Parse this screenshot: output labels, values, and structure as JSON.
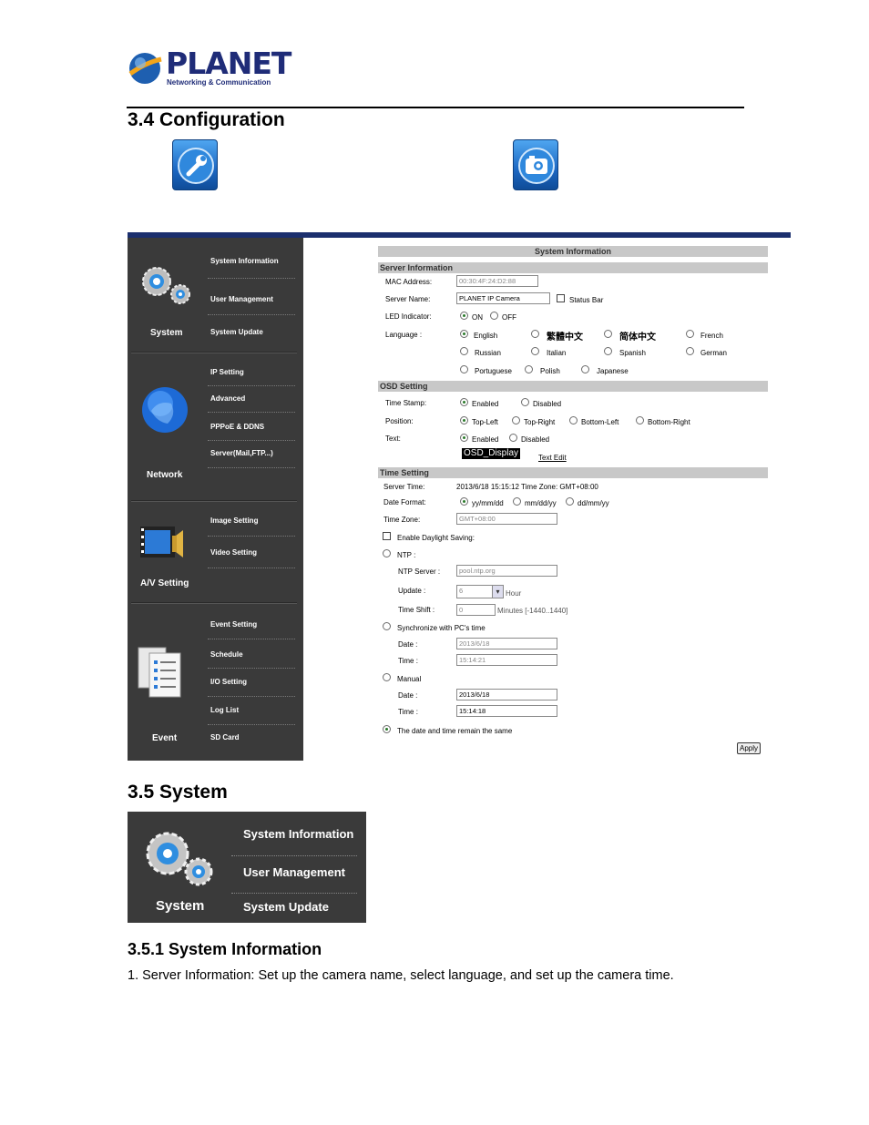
{
  "header": {
    "brand_name": "PLANET",
    "brand_tagline": "Networking & Communication"
  },
  "sections": {
    "config_title": "3.4 Configuration",
    "system_title": "3.5 System",
    "sysinfo_title": "3.5.1 System Information",
    "body_text": "1. Server Information: Set up the camera name, select language, and set up the camera time."
  },
  "icons": [
    "wrench-icon",
    "camera-icon",
    "gear-icon",
    "globe-icon",
    "film-icon",
    "documents-icon"
  ],
  "sidebar": {
    "groups": {
      "system": "System",
      "network": "Network",
      "av": "A/V Setting",
      "event": "Event"
    },
    "items": {
      "system_information": "System Information",
      "user_management": "User Management",
      "system_update": "System Update",
      "ip_setting": "IP Setting",
      "advanced": "Advanced",
      "pppoe": "PPPoE & DDNS",
      "server": "Server(Mail,FTP...)",
      "image_setting": "Image Setting",
      "video_setting": "Video Setting",
      "event_setting": "Event Setting",
      "schedule": "Schedule",
      "io_setting": "I/O Setting",
      "log_list": "Log List",
      "sd_card": "SD Card"
    }
  },
  "form": {
    "title": "System Information",
    "server_info": "Server Information",
    "mac_label": "MAC Address:",
    "mac_value": "00:30:4F:24:D2:88",
    "server_name_label": "Server Name:",
    "server_name_value": "PLANET IP Camera",
    "status_bar": "Status Bar",
    "led_label": "LED Indicator:",
    "led_on": "ON",
    "led_off": "OFF",
    "language_label": "Language :",
    "languages": [
      "English",
      "繁體中文",
      "简体中文",
      "French",
      "Russian",
      "Italian",
      "Spanish",
      "German",
      "Portuguese",
      "Polish",
      "Japanese"
    ],
    "osd_setting": "OSD Setting",
    "time_stamp_label": "Time Stamp:",
    "enabled": "Enabled",
    "disabled": "Disabled",
    "position_label": "Position:",
    "positions": [
      "Top-Left",
      "Top-Right",
      "Bottom-Left",
      "Bottom-Right"
    ],
    "text_label": "Text:",
    "osd_display": "OSD_Display",
    "text_edit": "Text Edit",
    "time_setting": "Time Setting",
    "server_time_label": "Server Time:",
    "server_time_value": "2013/6/18 15:15:12 Time Zone: GMT+08:00",
    "date_format_label": "Date Format:",
    "date_formats": [
      "yy/mm/dd",
      "mm/dd/yy",
      "dd/mm/yy"
    ],
    "time_zone_label": "Time Zone:",
    "time_zone_value": "GMT+08:00",
    "daylight": "Enable Daylight Saving:",
    "ntp": "NTP :",
    "ntp_server_label": "NTP Server :",
    "ntp_server_value": "pool.ntp.org",
    "update_label": "Update :",
    "update_value": "6",
    "hour": "Hour",
    "time_shift_label": "Time Shift :",
    "time_shift_value": "0",
    "minutes": "Minutes  [-1440..1440]",
    "sync_pc": "Synchronize with PC's time",
    "date_label": "Date :",
    "time_label": "Time :",
    "pc_date": "2013/6/18",
    "pc_time": "15:14:21",
    "manual": "Manual",
    "manual_date": "2013/6/18",
    "manual_time": "15:14:18",
    "remain_same": "The date and time remain the same",
    "apply": "Apply"
  },
  "system_menu": {
    "label": "System",
    "items": [
      "System Information",
      "User Management",
      "System Update"
    ]
  }
}
